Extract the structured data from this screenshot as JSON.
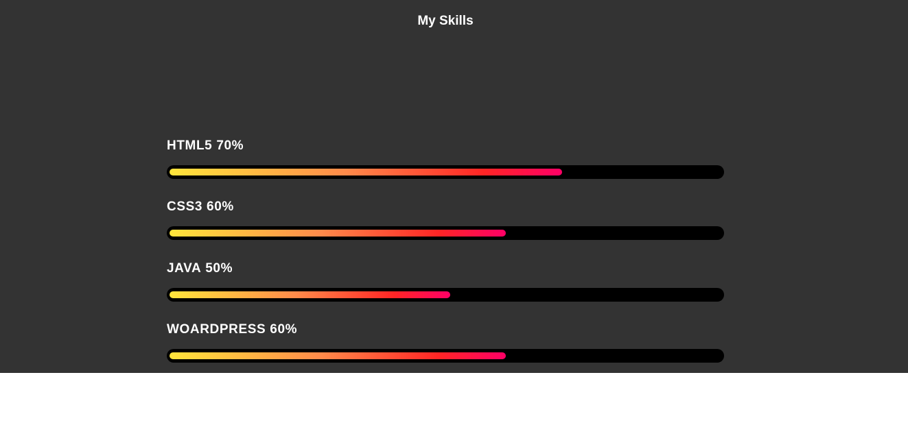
{
  "section": {
    "title": "My Skills",
    "background": "#333333"
  },
  "skills": [
    {
      "name": "HTML5",
      "percent_label": "70%",
      "level": 0.7
    },
    {
      "name": "CSS3",
      "percent_label": "60%",
      "level": 0.6
    },
    {
      "name": "JAVA",
      "percent_label": "50%",
      "level": 0.5
    },
    {
      "name": "WOARDPRESS",
      "percent_label": "60%",
      "level": 0.6
    }
  ],
  "colors": {
    "track": "#000000",
    "gradient_start": "#ffe53b",
    "gradient_end": "#ff0066",
    "text": "#ffffff"
  }
}
